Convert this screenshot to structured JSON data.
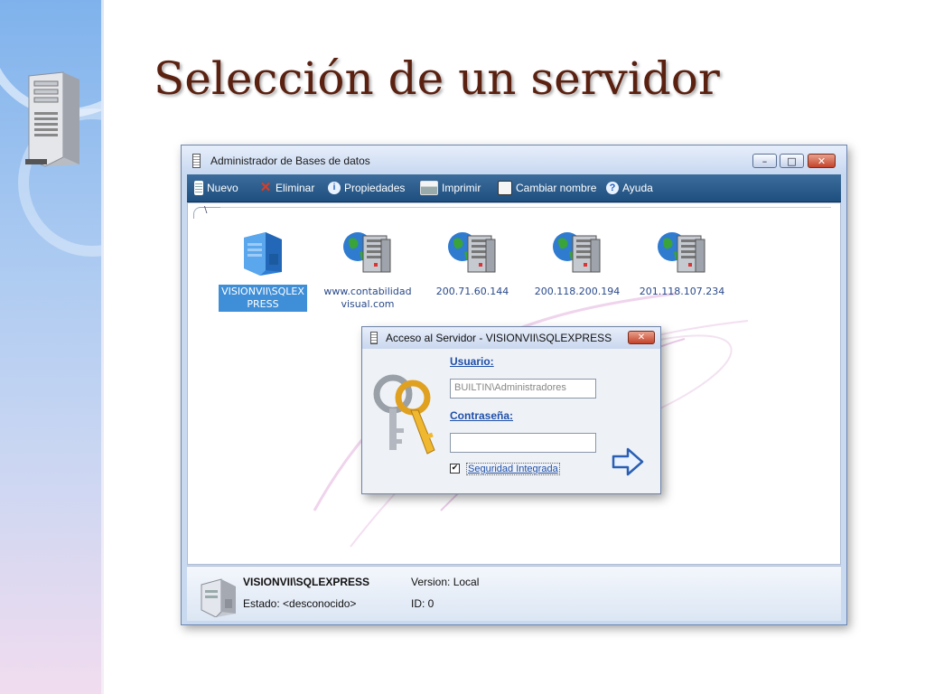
{
  "slide": {
    "title": "Selección de un servidor"
  },
  "window": {
    "title": "Administrador de Bases de datos",
    "controls": {
      "minimize": "–",
      "maximize": "□",
      "close": "✕"
    }
  },
  "toolbar": {
    "items": [
      {
        "label": "Nuevo",
        "icon": "new-db-icon"
      },
      {
        "label": "Eliminar",
        "icon": "delete-icon"
      },
      {
        "label": "Propiedades",
        "icon": "properties-icon"
      },
      {
        "label": "Imprimir",
        "icon": "print-icon"
      },
      {
        "label": "Cambiar nombre",
        "icon": "rename-icon"
      },
      {
        "label": "Ayuda",
        "icon": "help-icon"
      }
    ]
  },
  "breadcrumb": "\\",
  "servers": [
    {
      "line1": "VISIONVII\\SQLEX",
      "line2": "PRESS",
      "selected": true,
      "icon": "local-server-icon"
    },
    {
      "line1": "www.contabilidad",
      "line2": "visual.com",
      "selected": false,
      "icon": "network-server-icon"
    },
    {
      "line1": "200.71.60.144",
      "line2": "",
      "selected": false,
      "icon": "network-server-icon"
    },
    {
      "line1": "200.118.200.194",
      "line2": "",
      "selected": false,
      "icon": "network-server-icon"
    },
    {
      "line1": "201.118.107.234",
      "line2": "",
      "selected": false,
      "icon": "network-server-icon"
    }
  ],
  "dialog": {
    "title": "Acceso al Servidor - VISIONVII\\SQLEXPRESS",
    "close": "✕",
    "user_label": "Usuario:",
    "user_value": "BUILTIN\\Administradores",
    "password_label": "Contraseña:",
    "password_value": "",
    "integrated_label": "Seguridad Integrada",
    "integrated_checked": true,
    "check_mark": "✔"
  },
  "status": {
    "server_name": "VISIONVII\\SQLEXPRESS",
    "state": "Estado: <desconocido>",
    "version": "Version: Local",
    "id": "ID: 0"
  },
  "colors": {
    "title": "#5a2010",
    "toolbar": "#1f4f7e",
    "selection": "#3f8fd8",
    "link": "#1f4fa8"
  }
}
